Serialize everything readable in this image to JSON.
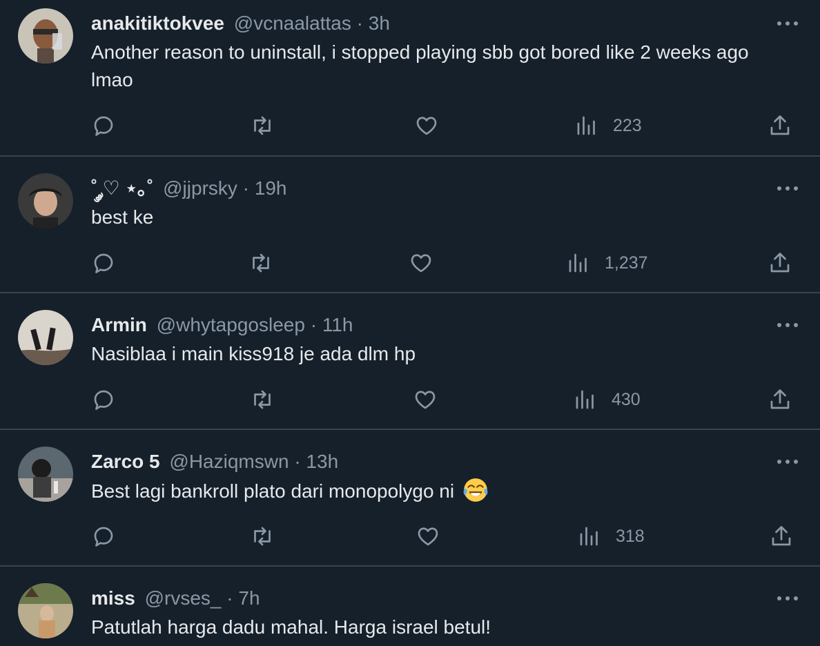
{
  "tweets": [
    {
      "name": "anakitiktokvee",
      "handle": "@vcnaalattas",
      "separator": "·",
      "time": "3h",
      "text": "Another reason to uninstall, i stopped playing sbb got bored like 2 weeks ago lmao",
      "views": "223"
    },
    {
      "name": "˚ ༘♡ ⋆｡˚",
      "handle": "@jjprsky",
      "separator": "·",
      "time": "19h",
      "text": "best ke",
      "views": "1,237"
    },
    {
      "name": "Armin",
      "handle": "@whytapgosleep",
      "separator": "·",
      "time": "11h",
      "text": "Nasiblaa i main kiss918 je ada dlm hp",
      "views": "430"
    },
    {
      "name": "Zarco 5",
      "handle": "@Haziqmswn",
      "separator": "·",
      "time": "13h",
      "text": "Best lagi bankroll plato dari monopolygo ni",
      "emoji": "face-with-tears-of-joy",
      "views": "318"
    },
    {
      "name": "miss",
      "handle": "@rvses_",
      "separator": "·",
      "time": "7h",
      "text": "Patutlah harga dadu mahal. Harga israel betul!"
    }
  ],
  "icons": {
    "reply": "reply-icon",
    "retweet": "retweet-icon",
    "like": "like-icon",
    "views": "views-icon",
    "share": "share-icon",
    "more": "more-options-icon"
  },
  "colors": {
    "background": "#15202b",
    "divider": "#38444d",
    "primary_text": "#e7e9ea",
    "secondary_text": "#8b98a5"
  }
}
